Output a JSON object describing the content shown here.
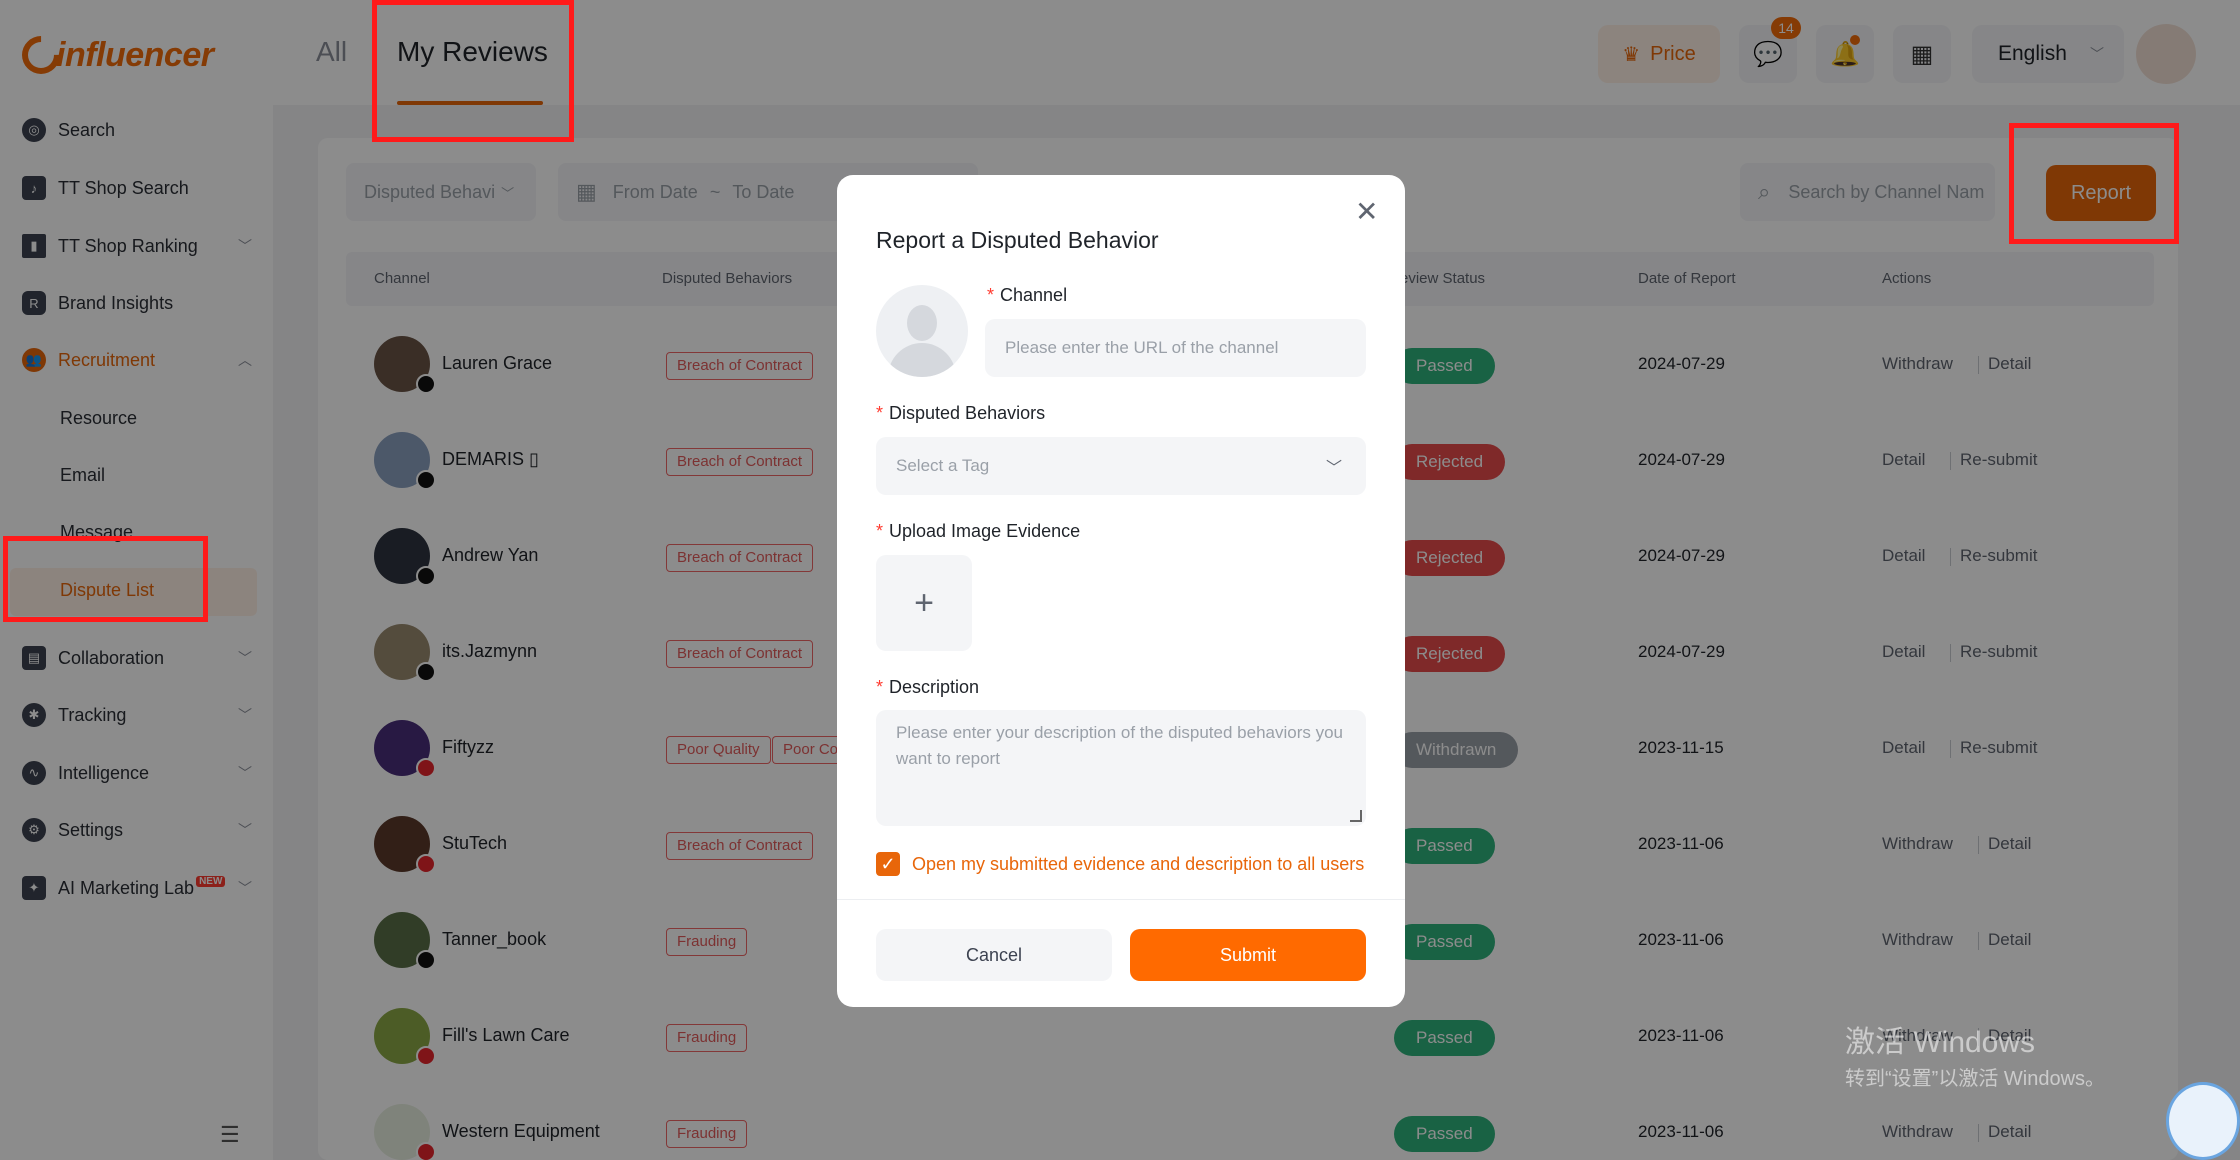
{
  "brand": {
    "logo_text": "influencer"
  },
  "sidebar": {
    "items": [
      {
        "label": "Search",
        "icon": "compass-icon"
      },
      {
        "label": "TT Shop Search",
        "icon": "shopping-bag-icon"
      },
      {
        "label": "TT Shop Ranking",
        "icon": "bar-chart-icon"
      },
      {
        "label": "Brand Insights",
        "icon": "brand-shield-icon"
      },
      {
        "label": "Recruitment",
        "icon": "users-icon"
      },
      {
        "label": "Collaboration",
        "icon": "collaboration-icon"
      },
      {
        "label": "Tracking",
        "icon": "tracking-icon"
      },
      {
        "label": "Intelligence",
        "icon": "trend-icon"
      },
      {
        "label": "Settings",
        "icon": "gear-icon"
      },
      {
        "label": "AI Marketing Lab",
        "icon": "ai-icon",
        "badge": "NEW"
      }
    ],
    "recruitment_sub": [
      "Resource",
      "Email",
      "Message",
      "Dispute List"
    ]
  },
  "header": {
    "tabs": [
      "All",
      "My Reviews"
    ],
    "price_label": "Price",
    "message_count": "14",
    "language": "English"
  },
  "filters": {
    "disputed_placeholder": "Disputed Behavi",
    "from_date": "From Date",
    "date_separator": "~",
    "to_date": "To Date",
    "search_placeholder": "Search by Channel Nam",
    "report_label": "Report"
  },
  "table": {
    "headers": [
      "Channel",
      "Disputed Behaviors",
      "Review Status",
      "Date of Report",
      "Actions"
    ],
    "header_partial_review": "eview Status",
    "rows": [
      {
        "name": "Lauren Grace",
        "platform": "tiktok",
        "tags": [
          "Breach of Contract"
        ],
        "status": "Passed",
        "date": "2024-07-29",
        "actions": [
          "Withdraw",
          "Detail"
        ]
      },
      {
        "name": "DEMARIS ▯",
        "platform": "tiktok",
        "tags": [
          "Breach of Contract"
        ],
        "status": "Rejected",
        "date": "2024-07-29",
        "actions": [
          "Detail",
          "Re-submit"
        ]
      },
      {
        "name": "Andrew Yan",
        "platform": "tiktok",
        "tags": [
          "Breach of Contract"
        ],
        "status": "Rejected",
        "date": "2024-07-29",
        "actions": [
          "Detail",
          "Re-submit"
        ]
      },
      {
        "name": "its.Jazmynn",
        "platform": "tiktok",
        "tags": [
          "Breach of Contract"
        ],
        "status": "Rejected",
        "date": "2024-07-29",
        "actions": [
          "Detail",
          "Re-submit"
        ]
      },
      {
        "name": "Fiftyzz",
        "platform": "youtube",
        "tags": [
          "Poor Quality",
          "Poor Co"
        ],
        "status": "Withdrawn",
        "date": "2023-11-15",
        "actions": [
          "Detail",
          "Re-submit"
        ]
      },
      {
        "name": "StuTech",
        "platform": "youtube",
        "tags": [
          "Breach of Contract"
        ],
        "status": "Passed",
        "date": "2023-11-06",
        "actions": [
          "Withdraw",
          "Detail"
        ]
      },
      {
        "name": "Tanner_book",
        "platform": "tiktok",
        "tags": [
          "Frauding"
        ],
        "status": "Passed",
        "date": "2023-11-06",
        "actions": [
          "Withdraw",
          "Detail"
        ]
      },
      {
        "name": "Fill's Lawn Care",
        "platform": "youtube",
        "tags": [
          "Frauding"
        ],
        "status": "Passed",
        "date": "2023-11-06",
        "actions": [
          "Withdraw",
          "Detail"
        ]
      },
      {
        "name": "Western Equipment",
        "platform": "youtube",
        "tags": [
          "Frauding"
        ],
        "status": "Passed",
        "date": "2023-11-06",
        "actions": [
          "Withdraw",
          "Detail"
        ]
      }
    ]
  },
  "modal": {
    "title": "Report a Disputed Behavior",
    "channel_label": "Channel",
    "channel_placeholder": "Please enter the URL of the channel",
    "behaviors_label": "Disputed Behaviors",
    "behaviors_placeholder": "Select a Tag",
    "upload_label": "Upload Image Evidence",
    "description_label": "Description",
    "description_placeholder": "Please enter your description of the disputed behaviors you want to report",
    "open_evidence_label": "Open my submitted evidence and description to all users",
    "open_evidence_checked": true,
    "cancel_label": "Cancel",
    "submit_label": "Submit",
    "required_mark": "*"
  },
  "watermark": {
    "line1": "激活 Windows",
    "line2": "转到“设置”以激活 Windows。"
  },
  "colors": {
    "accent": "#e8660a",
    "passed": "#2eb27c",
    "rejected": "#e74c4c",
    "withdrawn": "#9aa0a8",
    "highlight": "#ff1a1a"
  }
}
